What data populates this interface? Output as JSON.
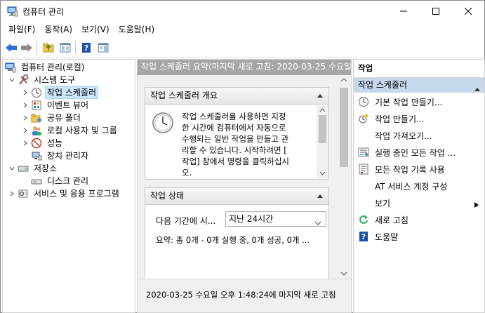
{
  "window": {
    "title": "컴퓨터 관리",
    "controls": {
      "minimize": "—",
      "maximize": "☐",
      "close": "✕"
    }
  },
  "menubar": [
    {
      "label": "파일(F)"
    },
    {
      "label": "동작(A)"
    },
    {
      "label": "보기(V)"
    },
    {
      "label": "도움말(H)"
    }
  ],
  "tree": {
    "root": "컴퓨터 관리(로컬)",
    "system_tools": "시스템 도구",
    "task_scheduler": "작업 스케줄러",
    "event_viewer": "이벤트 뷰어",
    "shared_folders": "공유 폴더",
    "local_users": "로컬 사용자 및 그룹",
    "performance": "성능",
    "device_manager": "장치 관리자",
    "storage": "저장소",
    "disk_management": "디스크 관리",
    "services": "서비스 및 응용 프로그램"
  },
  "center": {
    "header": "작업 스케줄러 요약(마지막 새로 고침: 2020-03-25 수요일",
    "overview": {
      "title": "작업 스케줄러 개요",
      "lines": [
        "작업 스케줄러를 사용하면 지정",
        "한 시간에 컴퓨터에서 자동으로",
        "수행되는 일반 작업을 만들고 관",
        "리할 수 있습니다. 시작하려면 [",
        "작업] 창에서 명령을 클릭하십시",
        "오."
      ]
    },
    "status": {
      "title": "작업 상태",
      "period_label": "다음 기간에 시...",
      "period_value": "지난 24시간",
      "summary": "요약: 총 0개 - 0개 실행 중, 0개 성공, 0개 ..."
    },
    "footer": "2020-03-25 수요일 오후 1:48:24에 마지막 새로 고침"
  },
  "actions": {
    "title": "작업",
    "group": "작업 스케줄러",
    "items": [
      {
        "label": "기본 작업 만들기..."
      },
      {
        "label": "작업 만들기..."
      },
      {
        "label": "작업 가져오기..."
      },
      {
        "label": "실행 중인 모든 작업 ..."
      },
      {
        "label": "모든 작업 기록 사용"
      },
      {
        "label": "AT 서비스 계정 구성"
      },
      {
        "label": "보기"
      },
      {
        "label": "새로 고침"
      },
      {
        "label": "도움말"
      }
    ]
  },
  "colors": {
    "center_header_bg": "#a6a6a6",
    "actions_group_bg": "#c6d8ec",
    "selection_bg": "#cce8ff",
    "toolbar_arrow_blue": "#2a6fd1",
    "help_icon_blue": "#1f4fa8"
  }
}
